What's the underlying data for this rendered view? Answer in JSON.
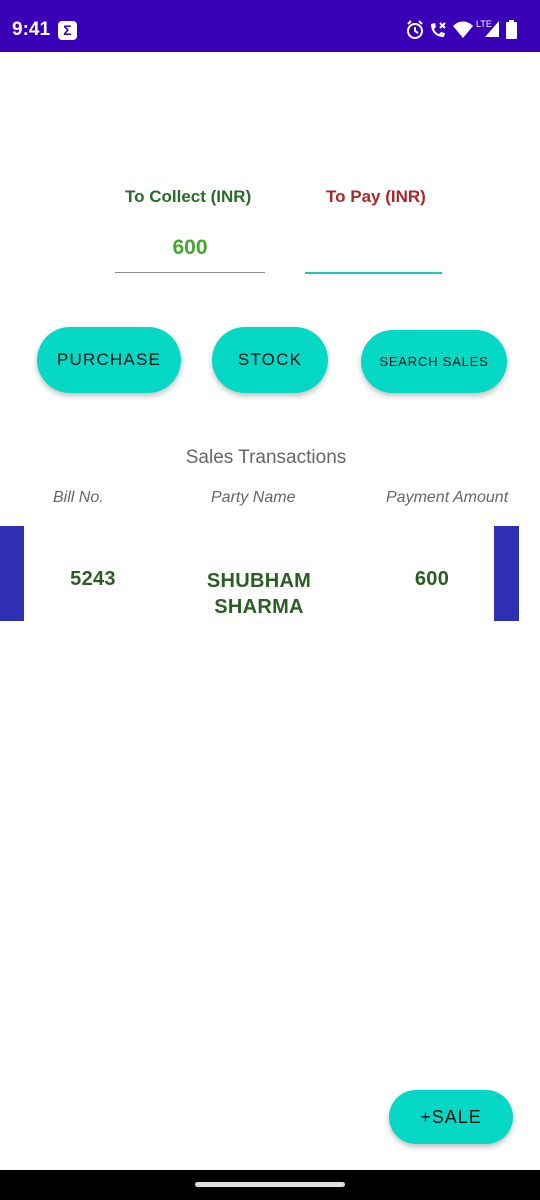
{
  "status_bar": {
    "time": "9:41",
    "notification_icon": "sigma-icon",
    "network_label": "LTE"
  },
  "summary": {
    "collect_label": "To Collect (INR)",
    "collect_value": "600",
    "pay_label": "To Pay (INR)",
    "pay_value": ""
  },
  "actions": {
    "purchase": "PURCHASE",
    "stock": "STOCK",
    "search_sales": "SEARCH SALES"
  },
  "transactions": {
    "title": "Sales Transactions",
    "columns": [
      "Bill No.",
      "Party Name",
      "Payment Amount"
    ],
    "rows": [
      {
        "bill_no": "5243",
        "party_name": "SHUBHAM SHARMA",
        "amount": "600"
      }
    ]
  },
  "fab": {
    "label": "+SALE"
  },
  "colors": {
    "status_bar": "#3a00b8",
    "accent": "#05d9c5",
    "row_marker": "#2f2fb3",
    "collect": "#2a6b2a",
    "pay": "#a82828"
  }
}
